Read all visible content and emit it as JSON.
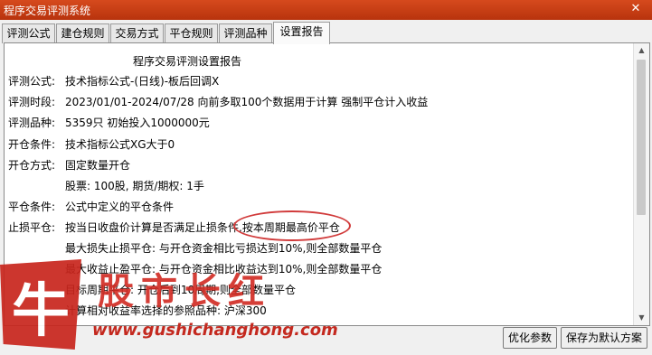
{
  "window": {
    "title": "程序交易评测系统",
    "close_glyph": "✕"
  },
  "tabs": [
    {
      "label": "评测公式",
      "active": false
    },
    {
      "label": "建仓规则",
      "active": false
    },
    {
      "label": "交易方式",
      "active": false
    },
    {
      "label": "平仓规则",
      "active": false
    },
    {
      "label": "评测品种",
      "active": false
    },
    {
      "label": "设置报告",
      "active": true
    }
  ],
  "report": {
    "heading": "程序交易评测设置报告",
    "rows": [
      {
        "label": "评测公式:",
        "value": "技术指标公式-(日线)-板后回调X"
      },
      {
        "label": "评测时段:",
        "value": "2023/01/01-2024/07/28 向前多取100个数据用于计算 强制平仓计入收益"
      },
      {
        "label": "评测品种:",
        "value": "5359只 初始投入1000000元"
      },
      {
        "label": "开仓条件:",
        "value": "技术指标公式XG大于0"
      },
      {
        "label": "开仓方式:",
        "value": "固定数量开仓"
      },
      {
        "label": "",
        "value": "股票: 100股, 期货/期权: 1手"
      },
      {
        "label": "平仓条件:",
        "value": "公式中定义的平仓条件"
      },
      {
        "label": "止损平仓:",
        "value": "按当日收盘价计算是否满足止损条件,按本周期最高价平仓"
      },
      {
        "label": "",
        "value": "最大损失止损平仓: 与开仓资金相比亏损达到10%,则全部数量平仓"
      },
      {
        "label": "",
        "value": "最大收益止盈平仓: 与开仓资金相比收益达到10%,则全部数量平仓"
      },
      {
        "label": "",
        "value": "目标周期平仓: 开仓后到10周期,则全部数量平仓"
      },
      {
        "label": "",
        "value": "计算相对收益率选择的参照品种: 沪深300"
      }
    ]
  },
  "buttons": {
    "optimize": "优化参数",
    "save_default": "保存为默认方案"
  },
  "watermark": {
    "logo_char": "牛",
    "chars": [
      "股",
      "市",
      "长",
      "红"
    ],
    "url": "www.gushichanghong.com"
  },
  "colors": {
    "titlebar": "#c23c14",
    "annotation": "#d13b3b",
    "watermark": "#c8251d"
  }
}
